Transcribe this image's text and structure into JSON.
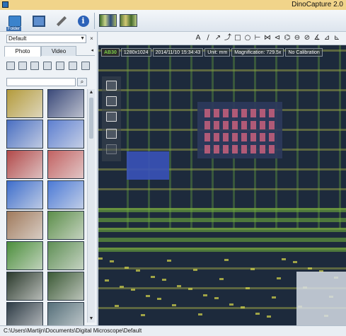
{
  "window": {
    "title": "DinoCapture 2.0"
  },
  "toolbar": {
    "buttons": [
      {
        "name": "folder",
        "label": "Folder",
        "icon": "folder-icon"
      },
      {
        "name": "screen",
        "icon": "monitor-icon"
      },
      {
        "name": "tools",
        "icon": "wrench-icon"
      },
      {
        "name": "info",
        "icon": "info-icon",
        "glyph": "i"
      }
    ]
  },
  "left_panel": {
    "profile_value": "Default",
    "tabs": [
      {
        "label": "Photo",
        "active": true
      },
      {
        "label": "Video",
        "active": false
      }
    ],
    "search_placeholder": "",
    "thumbnail_colors": [
      [
        "#b49b3c",
        "#3b4a7a"
      ],
      [
        "#4a6fc2",
        "#5d7fd0"
      ],
      [
        "#b24a4a",
        "#c26262"
      ],
      [
        "#3e6ecc",
        "#4c7ad6"
      ],
      [
        "#a07a5c",
        "#5c8e4a"
      ],
      [
        "#4c8e3c",
        "#5f8f55"
      ],
      [
        "#2b3a2c",
        "#3c5a36"
      ],
      [
        "#2e3c46",
        "#56707a"
      ]
    ]
  },
  "draw_tools": [
    "A",
    "∕",
    "↗",
    "⤴",
    "□",
    "○",
    "⊢",
    "⋈",
    "⊲",
    "⌬",
    "⊖",
    "⊘",
    "∡",
    "⊿",
    "⊾"
  ],
  "viewer": {
    "badge": "AB30",
    "resolution": "1280x1024",
    "timestamp": "2014/11/10 15:34:43",
    "unit": "Unit: mm",
    "magnification": "Magnification: 729.5x",
    "calibration": "No Calibration",
    "colors": {
      "bg": "#1d2a3c",
      "circuit_green": "#6fae3c",
      "circuit_yellow": "#d8d94a",
      "pad_pink": "#c8607c",
      "trace_blue": "#3a52b8"
    }
  },
  "status": {
    "path": "C:\\Users\\Martijn\\Documents\\Digital Microscope\\Default"
  }
}
